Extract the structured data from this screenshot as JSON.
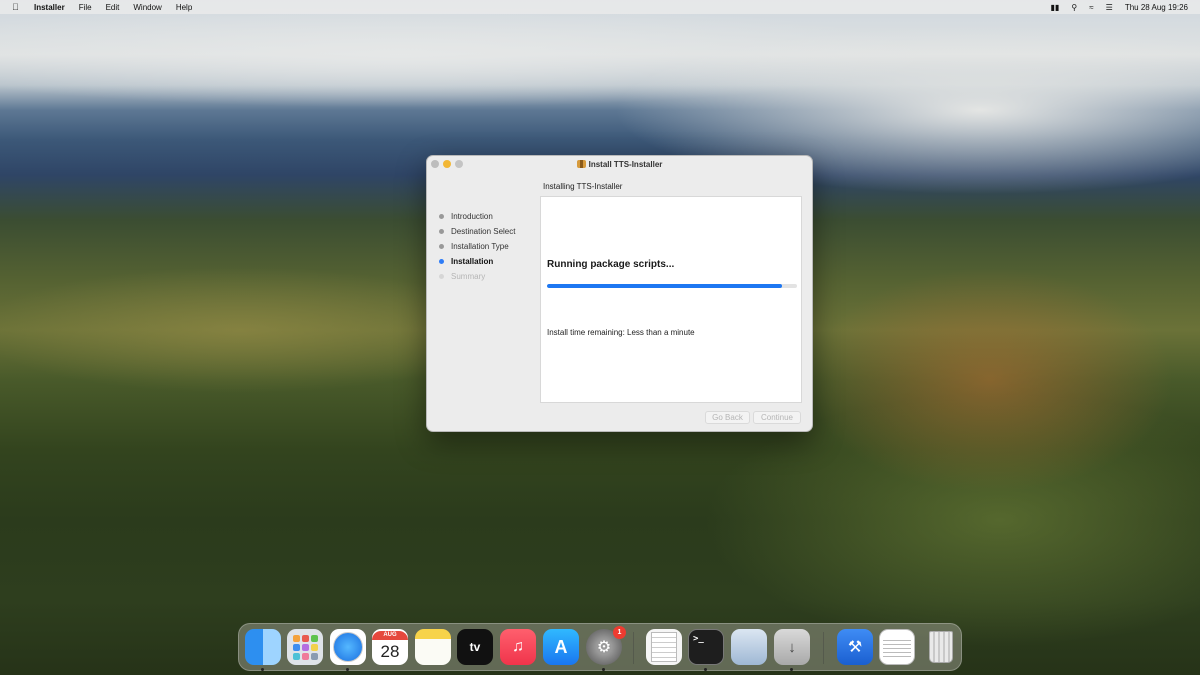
{
  "menubar": {
    "app_name": "Installer",
    "menus": [
      "File",
      "Edit",
      "Window",
      "Help"
    ],
    "status_icons": [
      "battery-icon",
      "search-icon",
      "wifi-icon",
      "control-center-icon"
    ],
    "clock": "Thu 28 Aug  19:26"
  },
  "window": {
    "title": "Install TTS-Installer",
    "heading": "Installing TTS-Installer",
    "steps": [
      {
        "label": "Introduction",
        "state": "done"
      },
      {
        "label": "Destination Select",
        "state": "done"
      },
      {
        "label": "Installation Type",
        "state": "done"
      },
      {
        "label": "Installation",
        "state": "active"
      },
      {
        "label": "Summary",
        "state": "pending"
      }
    ],
    "status": "Running package scripts...",
    "progress": 0.94,
    "remaining": "Install time remaining: Less than a minute",
    "buttons": {
      "back": "Go Back",
      "continue": "Continue"
    }
  },
  "dock": {
    "items": [
      "Finder",
      "Launchpad",
      "Safari",
      "Calendar",
      "Notes",
      "TV",
      "Music",
      "App Store",
      "System Settings",
      "TextEdit",
      "Terminal",
      "Preview",
      "Installer",
      "Xcode",
      "Document",
      "Trash"
    ],
    "calendar_month": "AUG",
    "calendar_day": "28",
    "tv_label": "tv",
    "settings_badge": "1",
    "terminal_prompt": ">_"
  },
  "colors": {
    "accent": "#1d77f2",
    "close": "#bdbdbd",
    "minimize": "#f2b735"
  }
}
